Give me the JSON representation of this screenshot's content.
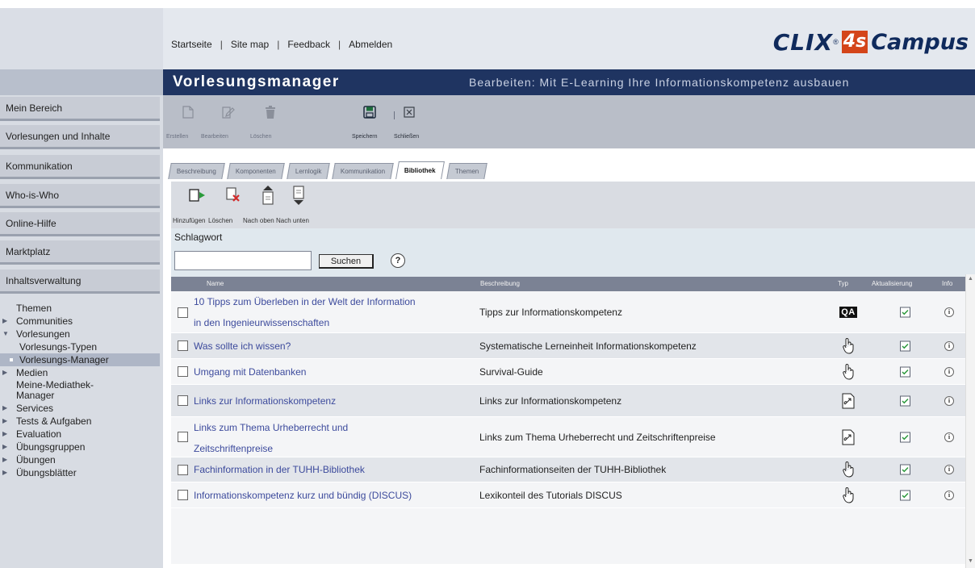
{
  "top_links": [
    "Startseite",
    "Site map",
    "Feedback",
    "Abmelden"
  ],
  "logo": {
    "clix": "CLIX",
    "reg": "®",
    "number": "4s",
    "campus": "Campus"
  },
  "title_bar": {
    "title": "Vorlesungsmanager",
    "edit_label": "Bearbeiten: Mit E-Learning Ihre Informationskompetenz ausbauen"
  },
  "sidebar": {
    "nav": [
      "Mein Bereich",
      "Vorlesungen und Inhalte",
      "Kommunikation",
      "Who-is-Who",
      "Online-Hilfe",
      "Marktplatz",
      "Inhaltsverwaltung"
    ],
    "tree": [
      {
        "label": "Themen",
        "type": "plain"
      },
      {
        "label": "Communities",
        "type": "collapsed"
      },
      {
        "label": "Vorlesungen",
        "type": "expanded"
      },
      {
        "label": "Vorlesungs-Typen",
        "type": "child"
      },
      {
        "label": "Vorlesungs-Manager",
        "type": "selected"
      },
      {
        "label": "Medien",
        "type": "collapsed"
      },
      {
        "label": "Meine-Mediathek-Manager",
        "type": "plain-wrap"
      },
      {
        "label": "Services",
        "type": "collapsed"
      },
      {
        "label": "Tests & Aufgaben",
        "type": "collapsed"
      },
      {
        "label": "Evaluation",
        "type": "collapsed"
      },
      {
        "label": "Übungsgruppen",
        "type": "collapsed"
      },
      {
        "label": "Übungen",
        "type": "collapsed"
      },
      {
        "label": "Übungsblätter",
        "type": "collapsed"
      }
    ]
  },
  "toolbar": {
    "create": "Erstellen",
    "edit": "Bearbeiten",
    "delete": "Löschen",
    "save": "Speichern",
    "close": "Schließen"
  },
  "tabs": [
    {
      "label": "Beschreibung",
      "active": false
    },
    {
      "label": "Komponenten",
      "active": false
    },
    {
      "label": "Lernlogik",
      "active": false
    },
    {
      "label": "Kommunikation",
      "active": false
    },
    {
      "label": "Bibliothek",
      "active": true
    },
    {
      "label": "Themen",
      "active": false
    }
  ],
  "actions": {
    "add": "Hinzufügen",
    "delete": "Löschen",
    "up": "Nach oben",
    "down": "Nach unten"
  },
  "search": {
    "label": "Schlagwort",
    "value": "",
    "button": "Suchen",
    "help": "?"
  },
  "table": {
    "headers": {
      "name": "Name",
      "desc": "Beschreibung",
      "type": "Typ",
      "update": "Aktualisierung",
      "info": "Info"
    },
    "rows": [
      {
        "name_lines": [
          "10 Tipps zum Überleben in der Welt der Information",
          "in den Ingenieurwissenschaften"
        ],
        "desc": "Tipps zur Informationskompetenz",
        "type_icon": "qa-icon",
        "type_text": "QA",
        "updated": true
      },
      {
        "name_lines": [
          "Was sollte ich wissen?"
        ],
        "desc": "Systematische Lerneinheit Informationskompetenz",
        "type_icon": "hand-pointer-icon",
        "updated": true
      },
      {
        "name_lines": [
          "Umgang mit Datenbanken"
        ],
        "desc": "Survival-Guide",
        "type_icon": "hand-pointer-icon",
        "updated": true
      },
      {
        "name_lines": [
          "Links zur Informationskompetenz"
        ],
        "desc": "Links zur Informationskompetenz",
        "type_icon": "link-document-icon",
        "updated": true
      },
      {
        "name_lines": [
          "Links zum Thema Urheberrecht und",
          "Zeitschriftenpreise"
        ],
        "desc": "Links zum Thema Urheberrecht und Zeitschriftenpreise",
        "type_icon": "link-document-icon",
        "updated": true
      },
      {
        "name_lines": [
          "Fachinformation in der TUHH-Bibliothek"
        ],
        "desc": "Fachinformationseiten der TUHH-Bibliothek",
        "type_icon": "hand-pointer-icon",
        "updated": true
      },
      {
        "name_lines": [
          "Informationskompetenz kurz und bündig (DISCUS)"
        ],
        "desc": "Lexikonteil des Tutorials DISCUS",
        "type_icon": "hand-pointer-icon",
        "updated": true
      }
    ]
  }
}
